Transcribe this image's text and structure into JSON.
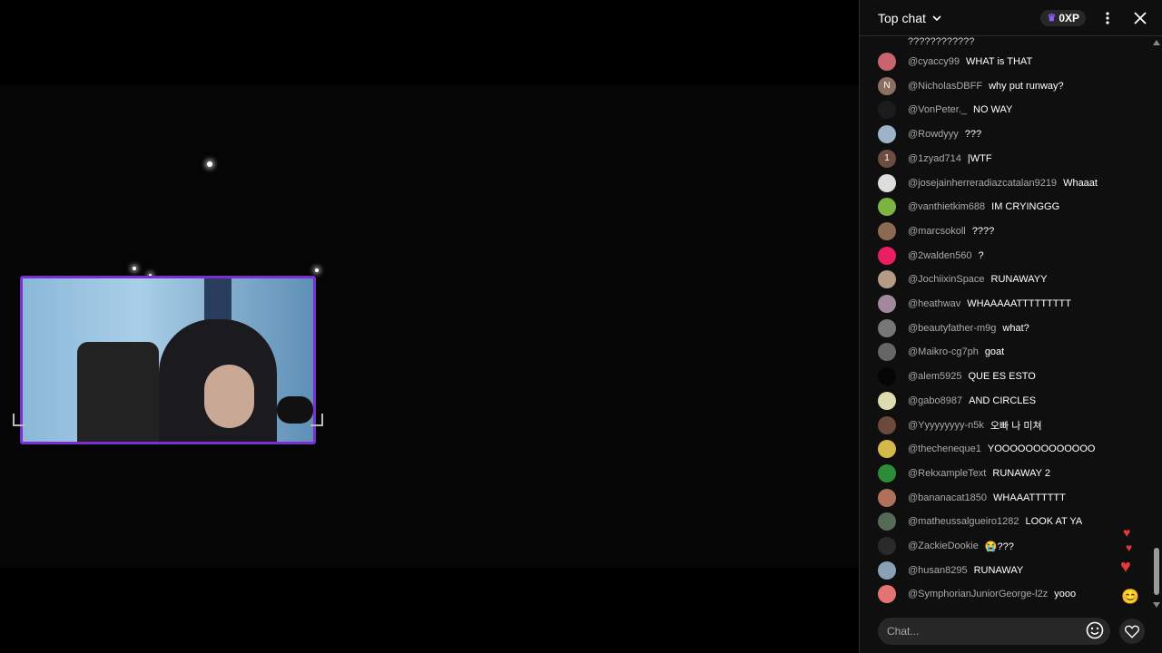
{
  "chat": {
    "title": "Top chat",
    "xp_label": "0XP",
    "truncated_top": "????????????",
    "messages": [
      {
        "author": "@cyaccy99",
        "text": "WHAT is THAT",
        "avatar_color": "#c8646e",
        "avatar_letter": ""
      },
      {
        "author": "@NicholasDBFF",
        "text": "why put runway?",
        "avatar_color": "#8d6e63",
        "avatar_letter": "N"
      },
      {
        "author": "@VonPeter._",
        "text": "NO WAY",
        "avatar_color": "#1c1c1c",
        "avatar_letter": ""
      },
      {
        "author": "@Rowdyyy",
        "text": "???",
        "avatar_color": "#9db4c8",
        "avatar_letter": ""
      },
      {
        "author": "@1zyad714",
        "text": "|WTF",
        "avatar_color": "#6d4c41",
        "avatar_letter": "1"
      },
      {
        "author": "@josejainherreradiazcatalan9219",
        "text": "Whaaat",
        "avatar_color": "#dddddd",
        "avatar_letter": ""
      },
      {
        "author": "@vanthietkim688",
        "text": "IM CRYINGGG",
        "avatar_color": "#7cb342",
        "avatar_letter": ""
      },
      {
        "author": "@marcsokoll",
        "text": "????",
        "avatar_color": "#8a6a52",
        "avatar_letter": ""
      },
      {
        "author": "@2walden560",
        "text": "?",
        "avatar_color": "#e91e63",
        "avatar_letter": ""
      },
      {
        "author": "@JochiixinSpace",
        "text": "RUNAWAYY",
        "avatar_color": "#b59a86",
        "avatar_letter": ""
      },
      {
        "author": "@heathwav",
        "text": "WHAAAAATTTTTTTTT",
        "avatar_color": "#a1889b",
        "avatar_letter": ""
      },
      {
        "author": "@beautyfather-m9g",
        "text": "what?",
        "avatar_color": "#777777",
        "avatar_letter": ""
      },
      {
        "author": "@Maikro-cg7ph",
        "text": "goat",
        "avatar_color": "#666666",
        "avatar_letter": ""
      },
      {
        "author": "@alem5925",
        "text": "QUE ES ESTO",
        "avatar_color": "#050505",
        "avatar_letter": ""
      },
      {
        "author": "@gabo8987",
        "text": "AND CIRCLES",
        "avatar_color": "#dcdcb0",
        "avatar_letter": ""
      },
      {
        "author": "@Yyyyyyyyy-n5k",
        "text": "오빠 나 미쳐",
        "avatar_color": "#6b4a3c",
        "avatar_letter": ""
      },
      {
        "author": "@thecheneque1",
        "text": "YOOOOOOOOOOOOO",
        "avatar_color": "#d4b84a",
        "avatar_letter": ""
      },
      {
        "author": "@RekxampleText",
        "text": "RUNAWAY 2",
        "avatar_color": "#2e8b3a",
        "avatar_letter": ""
      },
      {
        "author": "@bananacat1850",
        "text": "WHAAATTTTTT",
        "avatar_color": "#b0705a",
        "avatar_letter": ""
      },
      {
        "author": "@matheussalgueiro1282",
        "text": "LOOK AT YA",
        "avatar_color": "#556b55",
        "avatar_letter": ""
      },
      {
        "author": "@ZackieDookie",
        "text": "😭???",
        "avatar_color": "#2a2a2a",
        "avatar_letter": ""
      },
      {
        "author": "@husan8295",
        "text": "RUNAWAY",
        "avatar_color": "#8aa0b5",
        "avatar_letter": ""
      },
      {
        "author": "@SymphorianJuniorGeorge-l2z",
        "text": "yooo",
        "avatar_color": "#e57373",
        "avatar_letter": ""
      }
    ],
    "input_placeholder": "Chat..."
  },
  "colors": {
    "accent_purple": "#7b2fd0",
    "chat_bg": "#0f0f0f",
    "author_gray": "#aaaaaa"
  }
}
